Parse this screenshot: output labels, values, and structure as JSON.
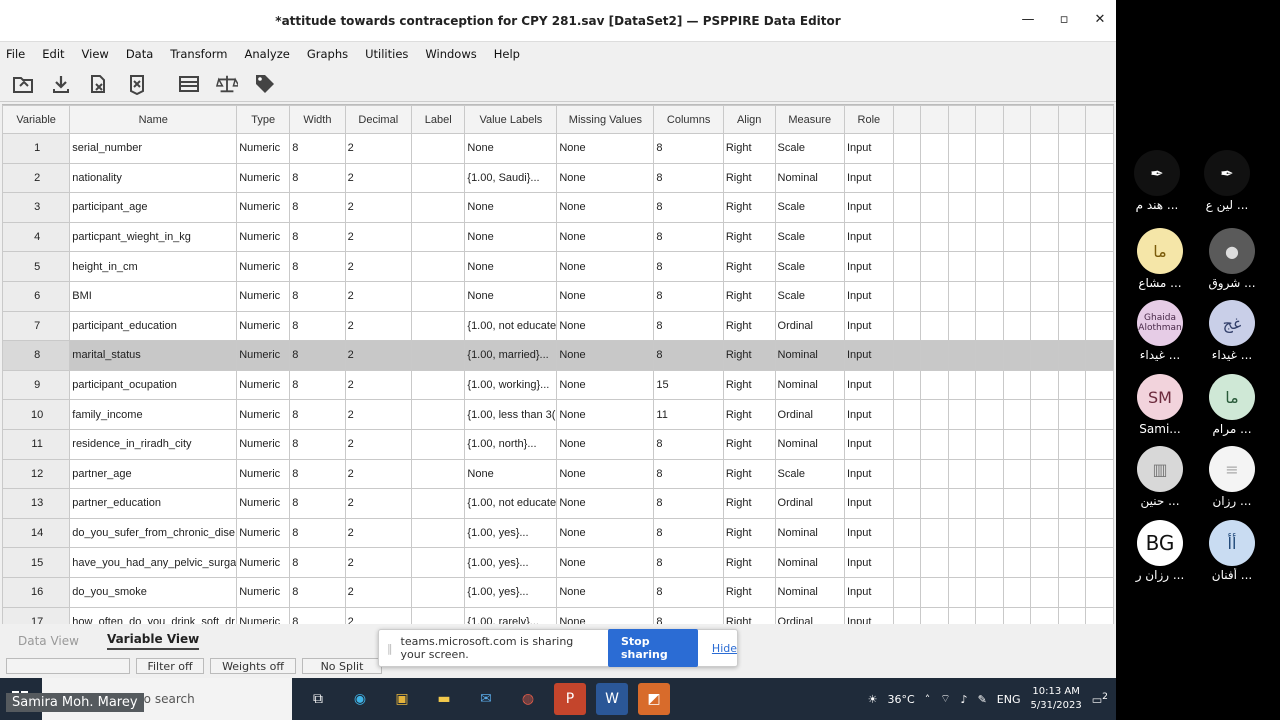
{
  "window": {
    "title": "*attitude towards contraception for CPY 281.sav [DataSet2] — PSPPIRE Data Editor",
    "minimize": "▪",
    "maximize": "▫",
    "close": "✕"
  },
  "menu": [
    "File",
    "Edit",
    "View",
    "Data",
    "Transform",
    "Analyze",
    "Graphs",
    "Utilities",
    "Windows",
    "Help"
  ],
  "toolbar_icons": [
    "open-icon",
    "save-icon",
    "goto-variable-icon",
    "goto-case-icon",
    "find-icon",
    "split-file-icon",
    "weight-cases-icon",
    "value-labels-icon"
  ],
  "columns": [
    "Variable",
    "Name",
    "Type",
    "Width",
    "Decimal",
    "Label",
    "Value Labels",
    "Missing Values",
    "Columns",
    "Align",
    "Measure",
    "Role"
  ],
  "rows": [
    {
      "n": "1",
      "name": "serial_number",
      "type": "Numeric",
      "width": "8",
      "dec": "2",
      "label": "",
      "vl": "None",
      "mv": "None",
      "cols": "8",
      "align": "Right",
      "measure": "Scale",
      "role": "Input"
    },
    {
      "n": "2",
      "name": "nationality",
      "type": "Numeric",
      "width": "8",
      "dec": "2",
      "label": "",
      "vl": "{1.00, Saudi}...",
      "mv": "None",
      "cols": "8",
      "align": "Right",
      "measure": "Nominal",
      "role": "Input"
    },
    {
      "n": "3",
      "name": "participant_age",
      "type": "Numeric",
      "width": "8",
      "dec": "2",
      "label": "",
      "vl": "None",
      "mv": "None",
      "cols": "8",
      "align": "Right",
      "measure": "Scale",
      "role": "Input"
    },
    {
      "n": "4",
      "name": "particpant_wieght_in_kg",
      "type": "Numeric",
      "width": "8",
      "dec": "2",
      "label": "",
      "vl": "None",
      "mv": "None",
      "cols": "8",
      "align": "Right",
      "measure": "Scale",
      "role": "Input"
    },
    {
      "n": "5",
      "name": "height_in_cm",
      "type": "Numeric",
      "width": "8",
      "dec": "2",
      "label": "",
      "vl": "None",
      "mv": "None",
      "cols": "8",
      "align": "Right",
      "measure": "Scale",
      "role": "Input"
    },
    {
      "n": "6",
      "name": "BMI",
      "type": "Numeric",
      "width": "8",
      "dec": "2",
      "label": "",
      "vl": "None",
      "mv": "None",
      "cols": "8",
      "align": "Right",
      "measure": "Scale",
      "role": "Input"
    },
    {
      "n": "7",
      "name": "participant_education",
      "type": "Numeric",
      "width": "8",
      "dec": "2",
      "label": "",
      "vl": "{1.00, not educate",
      "mv": "None",
      "cols": "8",
      "align": "Right",
      "measure": "Ordinal",
      "role": "Input"
    },
    {
      "n": "8",
      "name": "marital_status",
      "type": "Numeric",
      "width": "8",
      "dec": "2",
      "label": "",
      "vl": "{1.00, married}...",
      "mv": "None",
      "cols": "8",
      "align": "Right",
      "measure": "Nominal",
      "role": "Input"
    },
    {
      "n": "9",
      "name": "participant_ocupation",
      "type": "Numeric",
      "width": "8",
      "dec": "2",
      "label": "",
      "vl": "{1.00, working}...",
      "mv": "None",
      "cols": "15",
      "align": "Right",
      "measure": "Nominal",
      "role": "Input"
    },
    {
      "n": "10",
      "name": "family_income",
      "type": "Numeric",
      "width": "8",
      "dec": "2",
      "label": "",
      "vl": "{1.00, less than 3(",
      "mv": "None",
      "cols": "11",
      "align": "Right",
      "measure": "Ordinal",
      "role": "Input"
    },
    {
      "n": "11",
      "name": "residence_in_riradh_city",
      "type": "Numeric",
      "width": "8",
      "dec": "2",
      "label": "",
      "vl": "{1.00, north}...",
      "mv": "None",
      "cols": "8",
      "align": "Right",
      "measure": "Nominal",
      "role": "Input"
    },
    {
      "n": "12",
      "name": "partner_age",
      "type": "Numeric",
      "width": "8",
      "dec": "2",
      "label": "",
      "vl": "None",
      "mv": "None",
      "cols": "8",
      "align": "Right",
      "measure": "Scale",
      "role": "Input"
    },
    {
      "n": "13",
      "name": "partner_education",
      "type": "Numeric",
      "width": "8",
      "dec": "2",
      "label": "",
      "vl": "{1.00, not educate",
      "mv": "None",
      "cols": "8",
      "align": "Right",
      "measure": "Ordinal",
      "role": "Input"
    },
    {
      "n": "14",
      "name": "do_you_sufer_from_chronic_dise",
      "type": "Numeric",
      "width": "8",
      "dec": "2",
      "label": "",
      "vl": "{1.00, yes}...",
      "mv": "None",
      "cols": "8",
      "align": "Right",
      "measure": "Nominal",
      "role": "Input"
    },
    {
      "n": "15",
      "name": "have_you_had_any_pelvic_surga",
      "type": "Numeric",
      "width": "8",
      "dec": "2",
      "label": "",
      "vl": "{1.00, yes}...",
      "mv": "None",
      "cols": "8",
      "align": "Right",
      "measure": "Nominal",
      "role": "Input"
    },
    {
      "n": "16",
      "name": "do_you_smoke",
      "type": "Numeric",
      "width": "8",
      "dec": "2",
      "label": "",
      "vl": "{1.00, yes}...",
      "mv": "None",
      "cols": "8",
      "align": "Right",
      "measure": "Nominal",
      "role": "Input"
    },
    {
      "n": "17",
      "name": "how_often_do_you_drink_soft_dr",
      "type": "Numeric",
      "width": "8",
      "dec": "2",
      "label": "",
      "vl": "{1.00, rarely}...",
      "mv": "None",
      "cols": "8",
      "align": "Right",
      "measure": "Ordinal",
      "role": "Input"
    }
  ],
  "selected_row": "8",
  "tabs": {
    "data_view": "Data View",
    "variable_view": "Variable View"
  },
  "status": {
    "filter": "Filter off",
    "weights": "Weights off",
    "split": "No Split"
  },
  "share_bar": {
    "message": "teams.microsoft.com is sharing your screen.",
    "stop": "Stop sharing",
    "hide": "Hide"
  },
  "taskbar": {
    "search_placeholder": "Type here to search",
    "temperature": "36°C",
    "lang": "ENG",
    "time": "10:13 AM",
    "date": "5/31/2023",
    "notifications": "2"
  },
  "presenter": "Samira Moh. Marey",
  "participants": [
    {
      "initials": "",
      "name": "لين ع ..."
    },
    {
      "initials": "",
      "name": "هند م ..."
    },
    {
      "initials": "",
      "name": "شروق ..."
    },
    {
      "initials": "ما",
      "name": "مشاع ..."
    },
    {
      "initials": "غج",
      "name": "غيداء ..."
    },
    {
      "initials": "Ghaida Alothman",
      "name": "غيداء ..."
    },
    {
      "initials": "ما",
      "name": "مرام ..."
    },
    {
      "initials": "SM",
      "name": "Sami..."
    },
    {
      "initials": "",
      "name": "رزان ..."
    },
    {
      "initials": "",
      "name": "حنين ..."
    },
    {
      "initials": "أأ",
      "name": "أفنان ..."
    },
    {
      "initials": "BG",
      "name": "رزان ر ..."
    }
  ],
  "colors": {
    "selected_row": "#c8c8c8",
    "stop_button": "#2b6cd4",
    "taskbar": "#1f2b3a"
  }
}
